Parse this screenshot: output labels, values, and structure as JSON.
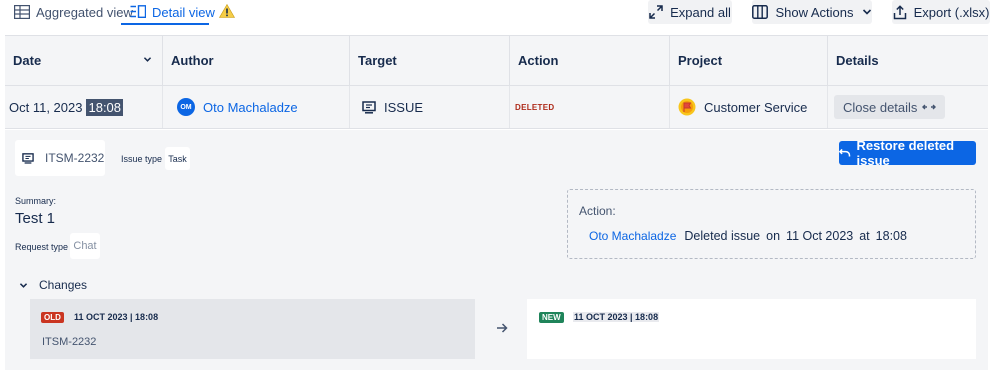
{
  "toolbar": {
    "aggregated_view": "Aggregated view",
    "detail_view": "Detail view",
    "expand_all": "Expand all",
    "show_actions": "Show Actions",
    "export": "Export (.xlsx)"
  },
  "table": {
    "headers": {
      "date": "Date",
      "author": "Author",
      "target": "Target",
      "action": "Action",
      "project": "Project",
      "details": "Details"
    },
    "row": {
      "date": "Oct 11, 2023",
      "time": "18:08",
      "author_initials": "OM",
      "author": "Oto Machaladze",
      "target": "ISSUE",
      "action": "DELETED",
      "project": "Customer Service",
      "close_details": "Close details"
    }
  },
  "details": {
    "issue_key": "ITSM-2232",
    "issue_type_label": "Issue type",
    "issue_type": "Task",
    "restore_label": "Restore deleted issue",
    "summary_label": "Summary:",
    "summary": "Test 1",
    "request_type_label": "Request type",
    "request_type": "Chat",
    "action_label": "Action:",
    "action_author": "Oto Machaladze",
    "action_text": "Deleted issue",
    "action_on": "on",
    "action_date": "11 Oct 2023",
    "action_at": "at",
    "action_time": "18:08",
    "changes_label": "Changes",
    "old_badge": "OLD",
    "old_timestamp": "11 OCT 2023 | 18:08",
    "old_value": "ITSM-2232",
    "new_badge": "NEW",
    "new_timestamp": "11 OCT 2023 | 18:08"
  },
  "colors": {
    "accent": "#0c66e4",
    "old_badge": "#ca3521",
    "new_badge": "#1f845a",
    "warning": "#f5cd47",
    "deleted_text": "#ae2a19"
  },
  "icons": {
    "aggregated": "table-grid-icon",
    "detail": "list-detail-icon",
    "warning": "warning-icon",
    "expand": "expand-arrows-icon",
    "columns": "columns-icon",
    "export": "export-icon",
    "issue": "issue-monitor-icon",
    "project": "project-flag-icon",
    "restore": "undo-icon",
    "arrow": "arrow-right-icon",
    "chevron": "chevron-down-icon"
  }
}
